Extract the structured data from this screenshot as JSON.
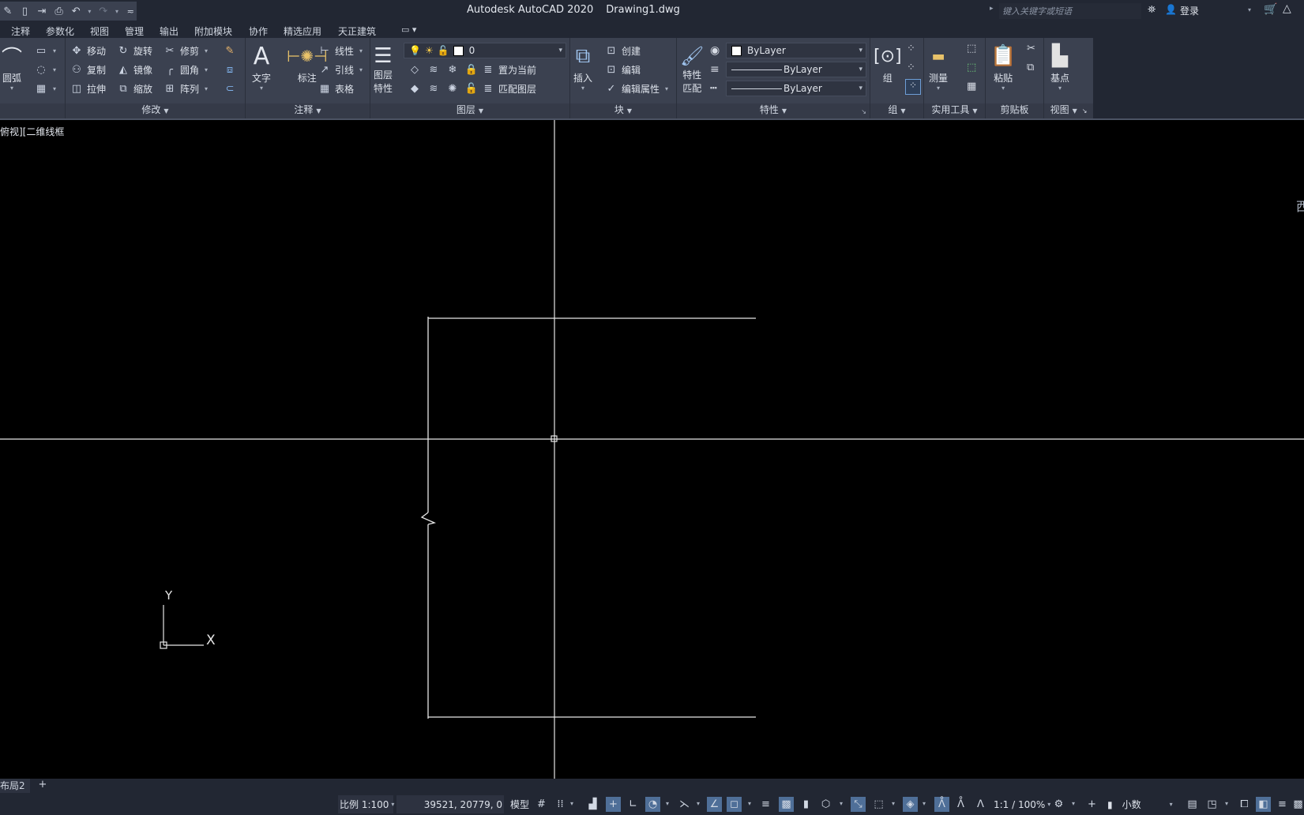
{
  "window": {
    "app_title": "Autodesk AutoCAD 2020",
    "file_name": "Drawing1.dwg"
  },
  "quick_access": {
    "icons": [
      "saveas-icon",
      "open-icon",
      "export-icon",
      "print-icon",
      "undo-icon",
      "redo-icon",
      "customize-icon"
    ]
  },
  "search": {
    "placeholder": "键入关键字或短语"
  },
  "account": {
    "login_label": "登录"
  },
  "tabs": [
    {
      "label": "注释"
    },
    {
      "label": "参数化"
    },
    {
      "label": "视图"
    },
    {
      "label": "管理"
    },
    {
      "label": "输出"
    },
    {
      "label": "附加模块"
    },
    {
      "label": "协作"
    },
    {
      "label": "精选应用"
    },
    {
      "label": "天正建筑"
    }
  ],
  "ribbon": {
    "draw": {
      "arc_label": "圆弧"
    },
    "modify": {
      "title": "修改",
      "move": "移动",
      "rotate": "旋转",
      "trim": "修剪",
      "copy": "复制",
      "mirror": "镜像",
      "fillet": "圆角",
      "stretch": "拉伸",
      "scale": "缩放",
      "array": "阵列"
    },
    "annotation": {
      "title": "注释",
      "text": "文字",
      "dimension": "标注",
      "linear": "线性",
      "leader": "引线",
      "table": "表格"
    },
    "layers": {
      "title": "图层",
      "layer_properties_line1": "图层",
      "layer_properties_line2": "特性",
      "current_layer": "0",
      "set_current": "置为当前",
      "match_layer": "匹配图层"
    },
    "block": {
      "title": "块",
      "insert": "插入",
      "create": "创建",
      "edit": "编辑",
      "edit_attributes": "编辑属性"
    },
    "properties": {
      "title": "特性",
      "match_line1": "特性",
      "match_line2": "匹配",
      "color": "ByLayer",
      "lineweight": "ByLayer",
      "linetype": "ByLayer"
    },
    "groups": {
      "title": "组",
      "group": "组"
    },
    "utilities": {
      "title": "实用工具",
      "measure": "测量"
    },
    "clipboard": {
      "title": "剪贴板",
      "paste": "粘贴"
    },
    "view": {
      "title": "视图",
      "base_point": "基点"
    }
  },
  "viewport": {
    "label": "俯视][二维线框",
    "viewcube_partial": "西",
    "ucs_x": "X",
    "ucs_y": "Y"
  },
  "layout_tabs": {
    "active": "布局2",
    "add": "+"
  },
  "status": {
    "scale": "比例 1:100",
    "coordinates": "39521, 20779, 0",
    "model": "模型",
    "annotation_scale": "1:1 / 100%",
    "units": "小数"
  }
}
